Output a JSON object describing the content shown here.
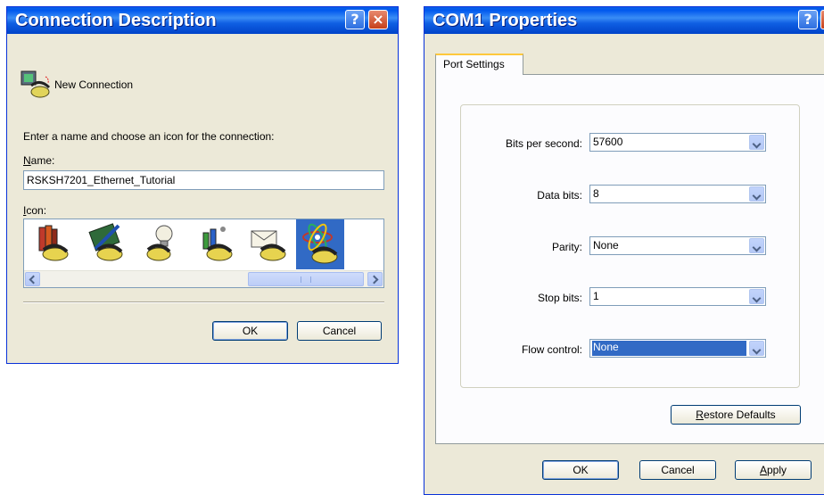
{
  "connection_dialog": {
    "title": "Connection Description",
    "help_button": "?",
    "close_button": "×",
    "connection_name_label": "New Connection",
    "instruction": "Enter a name and choose an icon for the connection:",
    "name_label": "Name:",
    "name_value": "RSKSH7201_Ethernet_Tutorial",
    "icon_label": "Icon:",
    "icons": [
      "books-phone-icon",
      "pen-phone-icon",
      "lightbulb-phone-icon",
      "chemistry-phone-icon",
      "envelope-phone-icon",
      "atom-phone-icon"
    ],
    "selected_icon": "atom-phone-icon",
    "ok_button": "OK",
    "cancel_button": "Cancel"
  },
  "com_dialog": {
    "title": "COM1 Properties",
    "help_button": "?",
    "close_button": "×",
    "tab_label": "Port Settings",
    "fields": [
      {
        "label": "Bits per second:",
        "value": "57600"
      },
      {
        "label": "Data bits:",
        "value": "8"
      },
      {
        "label": "Parity:",
        "value": "None"
      },
      {
        "label": "Stop bits:",
        "value": "1"
      },
      {
        "label": "Flow control:",
        "value": "None"
      }
    ],
    "focused_field": "Flow control:",
    "restore_button": "Restore Defaults",
    "ok_button": "OK",
    "cancel_button": "Cancel",
    "apply_button": "Apply"
  },
  "colors": {
    "title_bar": "#0058ee",
    "dialog_face": "#ece9d8",
    "selection": "#316ac5",
    "close_button": "#c6401a"
  }
}
